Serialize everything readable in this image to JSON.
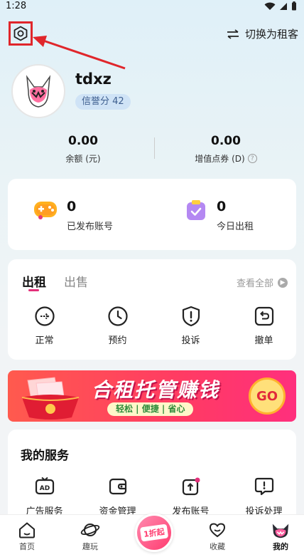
{
  "status_bar": {
    "time": "1:28"
  },
  "header": {
    "settings_icon": "settings-hexagon-icon",
    "switch_role_label": "切换为租客"
  },
  "profile": {
    "username": "tdxz",
    "credit_label": "信誉分 42"
  },
  "balances": [
    {
      "value": "0.00",
      "label": "余额 (元)"
    },
    {
      "value": "0.00",
      "label": "增值点券 (D)"
    }
  ],
  "stats": [
    {
      "value": "0",
      "label": "已发布账号"
    },
    {
      "value": "0",
      "label": "今日出租"
    }
  ],
  "orders": {
    "tabs": [
      "出租",
      "出售"
    ],
    "view_all": "查看全部",
    "items": [
      {
        "label": "正常",
        "icon": "arrow-circle-icon"
      },
      {
        "label": "预约",
        "icon": "clock-icon"
      },
      {
        "label": "投诉",
        "icon": "shield-alert-icon"
      },
      {
        "label": "撤单",
        "icon": "undo-icon"
      }
    ]
  },
  "banner": {
    "title": "合租托管赚钱",
    "subtitle": "轻松 | 便捷 | 省心",
    "cta": "GO"
  },
  "services": {
    "title": "我的服务",
    "items": [
      {
        "label": "广告服务",
        "icon": "ad-icon"
      },
      {
        "label": "资金管理",
        "icon": "wallet-icon"
      },
      {
        "label": "发布账号",
        "icon": "upload-icon"
      },
      {
        "label": "投诉处理",
        "icon": "complaint-icon"
      }
    ]
  },
  "bottom_nav": {
    "items": [
      {
        "label": "首页",
        "icon": "home-icon"
      },
      {
        "label": "趣玩",
        "icon": "planet-icon"
      },
      {
        "label": "收藏",
        "icon": "heart-icon"
      },
      {
        "label": "我的",
        "icon": "profile-mascot-icon"
      }
    ],
    "center_label": "1折起"
  },
  "colors": {
    "accent_pink": "#e3307a",
    "annotation_red": "#e0262b",
    "banner_red": "#ff3b63"
  }
}
